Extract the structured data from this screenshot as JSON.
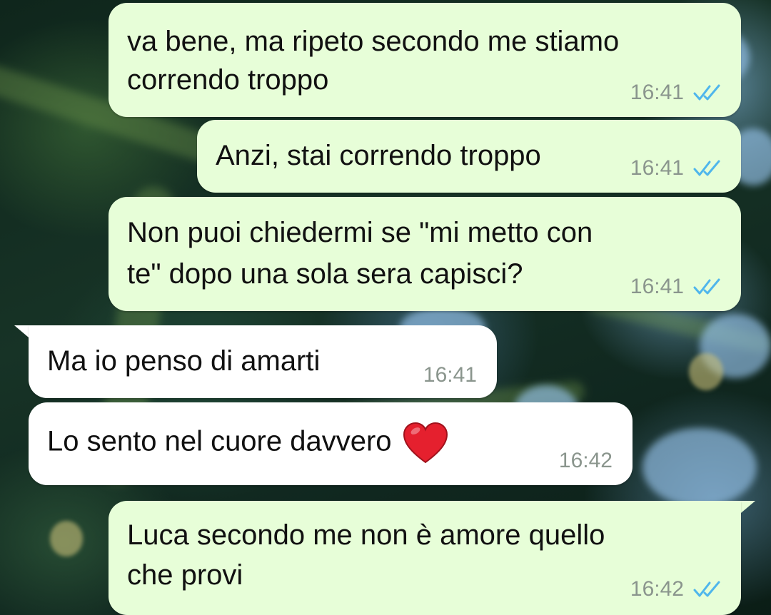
{
  "messages": [
    {
      "direction": "outgoing",
      "lines": [
        "va bene, ma ripeto secondo me stiamo",
        "correndo troppo"
      ],
      "time": "16:41",
      "status_icon": "double-check-read-icon"
    },
    {
      "direction": "outgoing",
      "lines": [
        "Anzi, stai correndo troppo"
      ],
      "time": "16:41",
      "status_icon": "double-check-read-icon"
    },
    {
      "direction": "outgoing",
      "lines": [
        "Non puoi chiedermi se \"mi metto con",
        "te\" dopo una sola sera capisci?"
      ],
      "time": "16:41",
      "status_icon": "double-check-read-icon"
    },
    {
      "direction": "incoming",
      "lines": [
        "Ma io penso di amarti"
      ],
      "time": "16:41"
    },
    {
      "direction": "incoming",
      "lines": [
        "Lo sento nel cuore davvero"
      ],
      "emoji": "red-heart-icon",
      "time": "16:42"
    },
    {
      "direction": "outgoing",
      "lines": [
        "Luca secondo me non è amore quello",
        "che provi"
      ],
      "time": "16:42",
      "status_icon": "double-check-read-icon"
    }
  ],
  "colors": {
    "outgoing_bubble": "#e7fed8",
    "incoming_bubble": "#ffffff",
    "read_ticks": "#4fb6ec",
    "timestamp": "#8a958d"
  }
}
